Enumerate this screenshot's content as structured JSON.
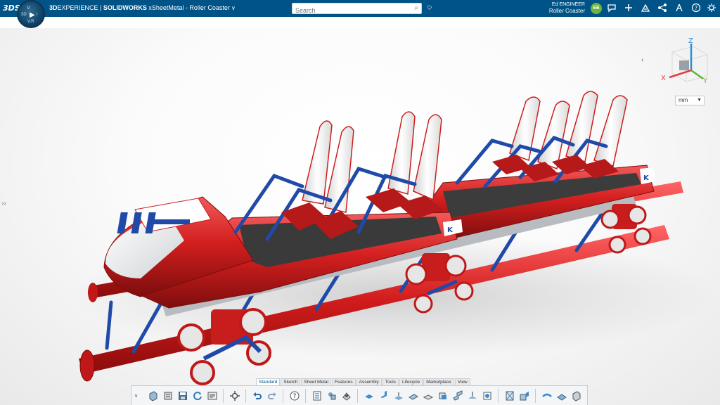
{
  "header": {
    "brand_logo": "3DS",
    "compass": {
      "top": "V",
      "left": "3D",
      "center": "▶",
      "right": "i",
      "bottom": "V.R"
    },
    "brand_3d": "3D",
    "brand_experience": "EXPERIENCE",
    "separator": " | ",
    "brand_solidworks": "SOLIDWORKS",
    "app_name": " xSheetMetal - Roller Coaster",
    "search_placeholder": "Search",
    "user_name": "Ed ENGINEER",
    "collab_space": "Roller Coaster",
    "avatar_initials": "EE",
    "icons": [
      "chat-icon",
      "add-icon",
      "share-icon",
      "network-icon",
      "compass-tool-icon",
      "help-icon",
      "settings-icon"
    ]
  },
  "viewport": {
    "triad": {
      "z": "Z",
      "x": "X",
      "y": "Y"
    },
    "unit": "mm"
  },
  "actionbar": {
    "tabs": [
      "Standard",
      "Sketch",
      "Sheet Metal",
      "Features",
      "Assembly",
      "Tools",
      "Lifecycle",
      "Marketplace",
      "View"
    ],
    "active_tab": "Standard",
    "colors": {
      "accent": "#005386",
      "coaster_red": "#d41f1f",
      "coaster_blue": "#1f4aa8"
    }
  }
}
